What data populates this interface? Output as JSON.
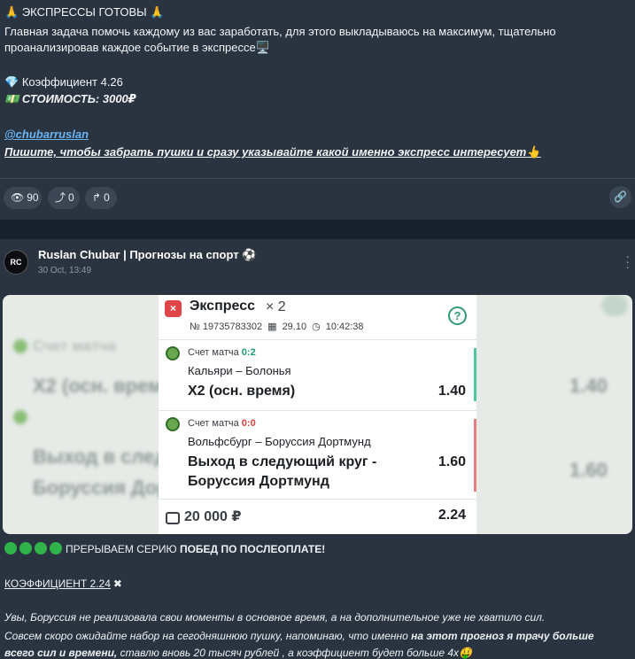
{
  "post1": {
    "title_icon": "🙏",
    "title": "ЭКСПРЕССЫ ГОТОВЫ",
    "desc_line1": "Главная задача помочь каждому из вас заработать, для этого выкладываюсь на максимум, тщательно",
    "desc_line2": "проанализировав каждое событие в экспрессе",
    "desc_icon": "🖥️",
    "coef_icon": "💎",
    "coef": "Коэффициент 4.26",
    "cost_icon": "💵",
    "cost": "СТОИМОСТЬ: 3000₽",
    "link": "@chubarruslan",
    "cta": "Пишите, чтобы забрать пушки и сразу указывайте какой именно экспресс интересует",
    "cta_icon": "👆",
    "reactions": [
      {
        "icon": "eye-icon",
        "glyph": "👁",
        "count": "90"
      },
      {
        "icon": "share-icon",
        "glyph": "⤴",
        "count": "0"
      },
      {
        "icon": "forward-icon",
        "glyph": "↱",
        "count": "0"
      }
    ],
    "link_icon": "🔗"
  },
  "post2": {
    "avatar_text": "RC",
    "channel_name": "Ruslan Chubar | Прогнозы на спорт ⚽",
    "date": "30 Oct, 13:49",
    "card": {
      "close": "×",
      "title": "Экспресс",
      "count": "× 2",
      "number": "№ 19735783302",
      "date": "29.10",
      "time": "10:42:38",
      "help": "?",
      "events": [
        {
          "score_label": "Счет матча",
          "score": "0:2",
          "score_status": "win",
          "teams": "Кальяри – Болонья",
          "bet": "Х2 (осн. время)",
          "odd": "1.40"
        },
        {
          "score_label": "Счет матча",
          "score": "0:0",
          "score_status": "loss",
          "teams": "Вольфсбург – Боруссия Дортмунд",
          "bet_line1": "Выход в следующий круг -",
          "bet_line2": "Боруссия Дортмунд",
          "odd": "1.60"
        }
      ],
      "stake": "20 000 ₽",
      "total": "2.24"
    },
    "streak_prefix": "ПРЕРЫВАЕМ СЕРИЮ",
    "streak_bold": "ПОБЕД ПО ПОСЛЕОПЛАТЕ!",
    "coef_line": "КОЭФФИЦИЕНТ 2.24",
    "coef_cross": "✖",
    "text1": "Увы, Боруссия не реализовала свои моменты в основное время, а на дополнительное уже не хватило сил.",
    "text2_a": "Совсем скоро ожидайте набор на сегодняшнюю пушку, напоминаю, что именно ",
    "text2_b": "на этот прогноз я трачу больше",
    "text3_a": "всего сил и времени,",
    "text3_b": " ставлю вновь 20 тысяч рублей , а коэффициент будет больше 4х",
    "text3_icon": "🤑"
  },
  "colors": {
    "background": "#17212b",
    "post_bg": "#2a3441",
    "link": "#6ab3f3",
    "win": "#1f9b6e",
    "loss": "#d9413f",
    "dot": "#2fb34a"
  }
}
